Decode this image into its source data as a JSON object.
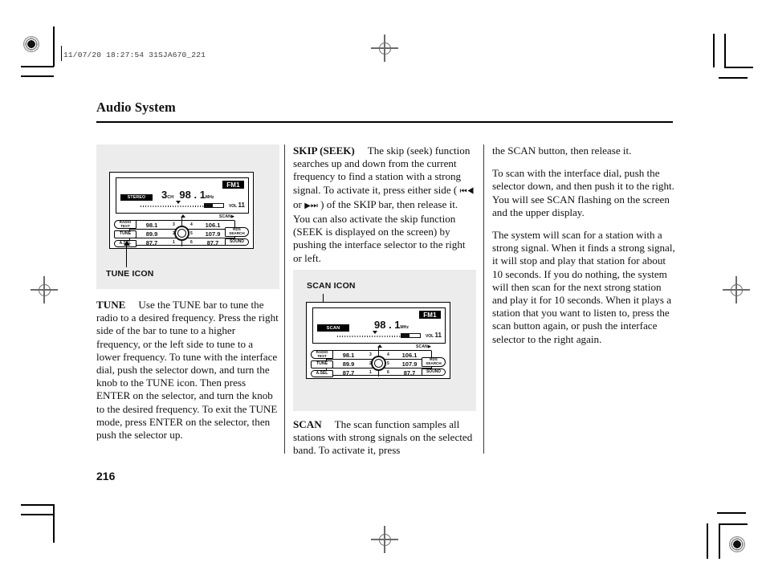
{
  "slug": {
    "text": "11/07/20 18:27:54 31SJA670_221"
  },
  "page": {
    "title": "Audio System",
    "number": "216"
  },
  "figures": [
    {
      "caption": "TUNE ICON",
      "display": {
        "status_badge": "STEREO",
        "channel_number": "3",
        "channel_unit": "CH",
        "frequency": "98 . 1",
        "frequency_unit": "MHz",
        "band": "FM1",
        "vol_label": "VOL",
        "vol_value": "11",
        "scan_label": "SCAN"
      },
      "presets": [
        {
          "num": "3",
          "freq": "98.1"
        },
        {
          "num": "4",
          "freq": "106.1"
        },
        {
          "num": "2",
          "freq": "89.9"
        },
        {
          "num": "5",
          "freq": "107.9"
        },
        {
          "num": "1",
          "freq": "87.7"
        },
        {
          "num": "6",
          "freq": "87.7"
        }
      ],
      "left_buttons": [
        "RADIO TEXT",
        "TUNE",
        "A.SEL"
      ],
      "right_buttons": [
        "RDS SEARCH",
        "SOUND"
      ]
    },
    {
      "caption": "SCAN ICON",
      "display": {
        "status_badge": "SCAN",
        "channel_number": "",
        "channel_unit": "",
        "frequency": "98 . 1",
        "frequency_unit": "MHz",
        "band": "FM1",
        "vol_label": "VOL",
        "vol_value": "11",
        "scan_label": "SCAN"
      },
      "presets": [
        {
          "num": "3",
          "freq": "98.1"
        },
        {
          "num": "4",
          "freq": "106.1"
        },
        {
          "num": "2",
          "freq": "89.9"
        },
        {
          "num": "5",
          "freq": "107.9"
        },
        {
          "num": "1",
          "freq": "87.7"
        },
        {
          "num": "6",
          "freq": "87.7"
        }
      ],
      "left_buttons": [
        "RADIO TEXT",
        "TUNE",
        "A.SEL"
      ],
      "right_buttons": [
        "RDS SEARCH",
        "SOUND"
      ]
    }
  ],
  "column1": {
    "tune": {
      "lead": "TUNE",
      "text": "Use the TUNE bar to tune the radio to a desired frequency. Press the right side of the bar to tune to a higher frequency, or the left side to tune to a lower frequency. To tune with the interface dial, push the selector down, and turn the knob to the TUNE icon. Then press ENTER on the selector, and turn the knob to the desired frequency. To exit the TUNE mode, press ENTER on the selector, then push the selector up."
    }
  },
  "column2": {
    "skip": {
      "lead": "SKIP (SEEK)",
      "part1": "The skip (seek) function searches up and down from the current frequency to find a station with a strong signal. To activate it, press either side ( ",
      "icon_prev": "⏮◀",
      "mid": " or ",
      "icon_next": "▶⏭",
      "part2": " ) of the SKIP bar, then release it. You can also activate the skip function (SEEK is displayed on the screen) by pushing the interface selector to the right or left."
    },
    "scan": {
      "lead": "SCAN",
      "text": "The scan function samples all stations with strong signals on the selected band. To activate it, press"
    }
  },
  "column3": {
    "p1": "the SCAN button, then release it.",
    "p2": "To scan with the interface dial, push the selector down, and then push it to the right. You will see SCAN flashing on the screen and the upper display.",
    "p3": "The system will scan for a station with a strong signal. When it finds a strong signal, it will stop and play that station for about 10 seconds. If you do nothing, the system will then scan for the next strong station and play it for 10 seconds. When it plays a station that you want to listen to, press the scan button again, or push the interface selector to the right again."
  }
}
